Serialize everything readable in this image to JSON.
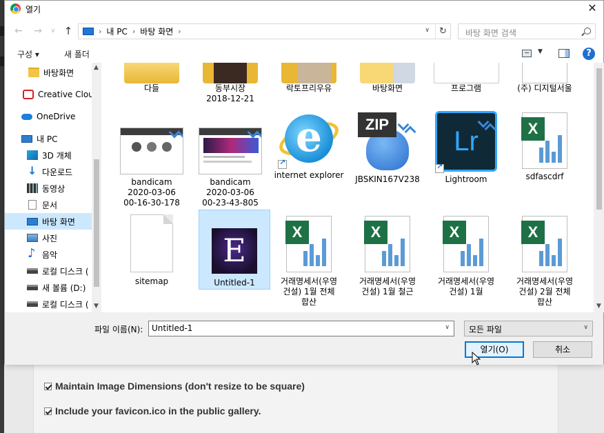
{
  "dialog": {
    "title": "열기",
    "close_label": "✕",
    "breadcrumb": [
      "내 PC",
      "바탕 화면"
    ],
    "search_placeholder": "바탕 화면 검색",
    "toolbar": {
      "organize": "구성 ▾",
      "new_folder": "새 폴더",
      "help": "?"
    },
    "sidebar": [
      "바탕화면",
      "Creative Cloud",
      "OneDrive",
      "내 PC",
      "3D 개체",
      "다운로드",
      "동영상",
      "문서",
      "바탕 화면",
      "사진",
      "음악",
      "로컬 디스크 (",
      "새 볼륨 (D:)",
      "로컬 디스크 ("
    ],
    "files": [
      {
        "name": "다들",
        "kind": "folder"
      },
      {
        "name": "동부시장\n2018-12-21",
        "kind": "folder"
      },
      {
        "name": "락토프리우유",
        "kind": "folder"
      },
      {
        "name": "바탕화면",
        "kind": "folder"
      },
      {
        "name": "프로그램",
        "kind": "folder"
      },
      {
        "name": "(주) 디지털서울",
        "kind": "excel"
      },
      {
        "name": "bandicam\n2020-03-06\n00-16-30-178",
        "kind": "image"
      },
      {
        "name": "bandicam\n2020-03-06\n00-23-43-805",
        "kind": "image"
      },
      {
        "name": "internet explorer",
        "kind": "shortcut"
      },
      {
        "name": "JBSKIN167V238",
        "kind": "zip"
      },
      {
        "name": "Lightroom",
        "kind": "shortcut"
      },
      {
        "name": "sdfascdrf",
        "kind": "excel"
      },
      {
        "name": "sitemap",
        "kind": "file"
      },
      {
        "name": "Untitled-1",
        "kind": "image",
        "selected": true
      },
      {
        "name": "거래명세서(우영\n건설) 1월 전체\n합산",
        "kind": "excel"
      },
      {
        "name": "거래명세서(우영\n건설) 1월 철근",
        "kind": "excel"
      },
      {
        "name": "거래명세서(우영\n건설) 1월",
        "kind": "excel"
      },
      {
        "name": "거래명세서(우영\n건설) 2월 전체\n합산",
        "kind": "excel"
      }
    ],
    "zip_tag": "ZIP",
    "lr_tag": "Lr",
    "untitled_glyph": "E",
    "filename_label": "파일 이름(N):",
    "filename_value": "Untitled-1",
    "filetype_value": "모든 파일",
    "open_button": "열기(O)",
    "cancel_button": "취소"
  },
  "background_page": {
    "option1": "Maintain Image Dimensions (don't resize to be square)",
    "option2": "Include your favicon.ico in the public gallery."
  },
  "colors": {
    "selection": "#cce8ff",
    "accent": "#0078d7"
  }
}
